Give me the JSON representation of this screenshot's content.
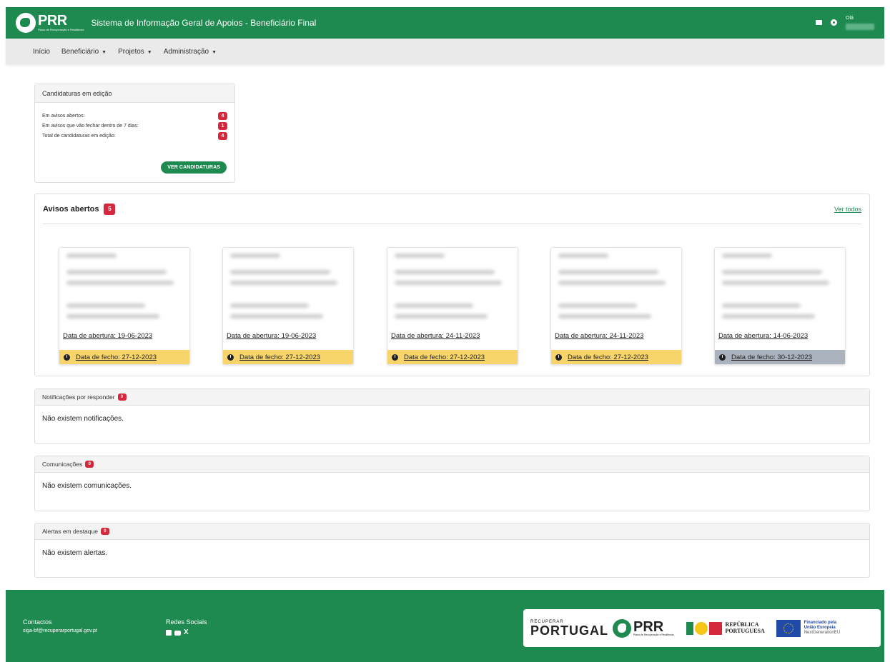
{
  "header": {
    "logo": "PRR",
    "logo_sub": "Plano de Recuperação e Resiliência",
    "app_title": "Sistema de Informação Geral de Apoios - Beneficiário Final",
    "greeting": "Olá"
  },
  "menu": [
    {
      "label": "Início",
      "dropdown": false
    },
    {
      "label": "Beneficiário",
      "dropdown": true
    },
    {
      "label": "Projetos",
      "dropdown": true
    },
    {
      "label": "Administração",
      "dropdown": true
    }
  ],
  "candidaturas": {
    "title": "Candidaturas em edição",
    "rows": [
      {
        "label": "Em avisos abertos:",
        "count": "4"
      },
      {
        "label": "Em avisos que vão fechar dentro de 7 dias:",
        "count": "1"
      },
      {
        "label": "Total de candidaturas em edição:",
        "count": "4"
      }
    ],
    "button": "VER CANDIDATURAS"
  },
  "avisos": {
    "title": "Avisos abertos",
    "count": "5",
    "ver_todos": "Ver todos",
    "cards": [
      {
        "abertura": "Data de abertura: 19-06-2023",
        "fecho": "Data de fecho: 27-12-2023",
        "fecho_color": "#f7d56b"
      },
      {
        "abertura": "Data de abertura: 19-06-2023",
        "fecho": "Data de fecho: 27-12-2023",
        "fecho_color": "#f7d56b"
      },
      {
        "abertura": "Data de abertura: 24-11-2023",
        "fecho": "Data de fecho: 27-12-2023",
        "fecho_color": "#f7d56b"
      },
      {
        "abertura": "Data de abertura: 24-11-2023",
        "fecho": "Data de fecho: 27-12-2023",
        "fecho_color": "#f7d56b"
      },
      {
        "abertura": "Data de abertura: 14-06-2023",
        "fecho": "Data de fecho: 30-12-2023",
        "fecho_color": "#aab2bd"
      }
    ]
  },
  "notificacoes": {
    "title": "Notificações por responder",
    "count": "0",
    "empty": "Não existem notificações."
  },
  "comunicacoes": {
    "title": "Comunicações",
    "count": "0",
    "empty": "Não existem comunicações."
  },
  "alertas": {
    "title": "Alertas em destaque",
    "count": "0",
    "empty": "Não existem alertas."
  },
  "footer": {
    "contactos_title": "Contactos",
    "contactos_email": "siga-bf@recuperarportugal.gov.pt",
    "redes_title": "Redes Sociais",
    "recuperar": "RECUPERAR",
    "portugal": "PORTUGAL",
    "prr": "PRR",
    "prr_sub": "Plano de Recuperação e Resiliência",
    "republica_1": "REPÚBLICA",
    "republica_2": "PORTUGUESA",
    "eu_1": "Financiado pela",
    "eu_2": "União Europeia",
    "eu_3": "NextGenerationEU"
  },
  "colors": {
    "brand_green": "#1e8a50",
    "badge_red": "#d6283c",
    "fecho_yellow": "#f7d56b",
    "fecho_grey": "#aab2bd"
  }
}
